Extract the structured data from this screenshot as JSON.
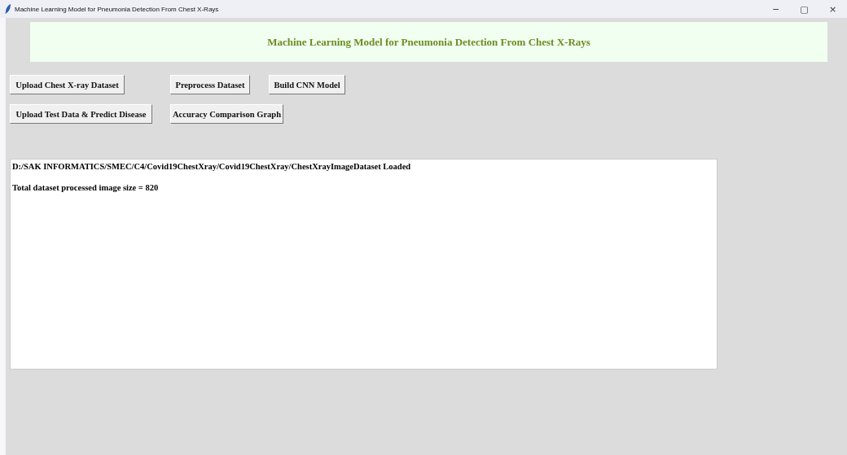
{
  "window": {
    "title": "Machine Learning Model for Pneumonia Detection From Chest X-Rays",
    "controls": [
      "−",
      "▢",
      "×"
    ]
  },
  "heading": "Machine Learning Model for Pneumonia Detection From Chest X-Rays",
  "button_rows": [
    [
      "Upload  Chest X-ray Dataset",
      "Preprocess Dataset",
      "Build CNN Model"
    ],
    [
      "Upload Test Data & Predict Disease",
      "Accuracy Comparison Graph"
    ]
  ],
  "output_text": [
    "D:/SAK INFORMATICS/SMEC/C4/Covid19ChestXray/Covid19ChestXray/ChestXrayImageDataset Loaded",
    "Total dataset processed image size = 820"
  ]
}
